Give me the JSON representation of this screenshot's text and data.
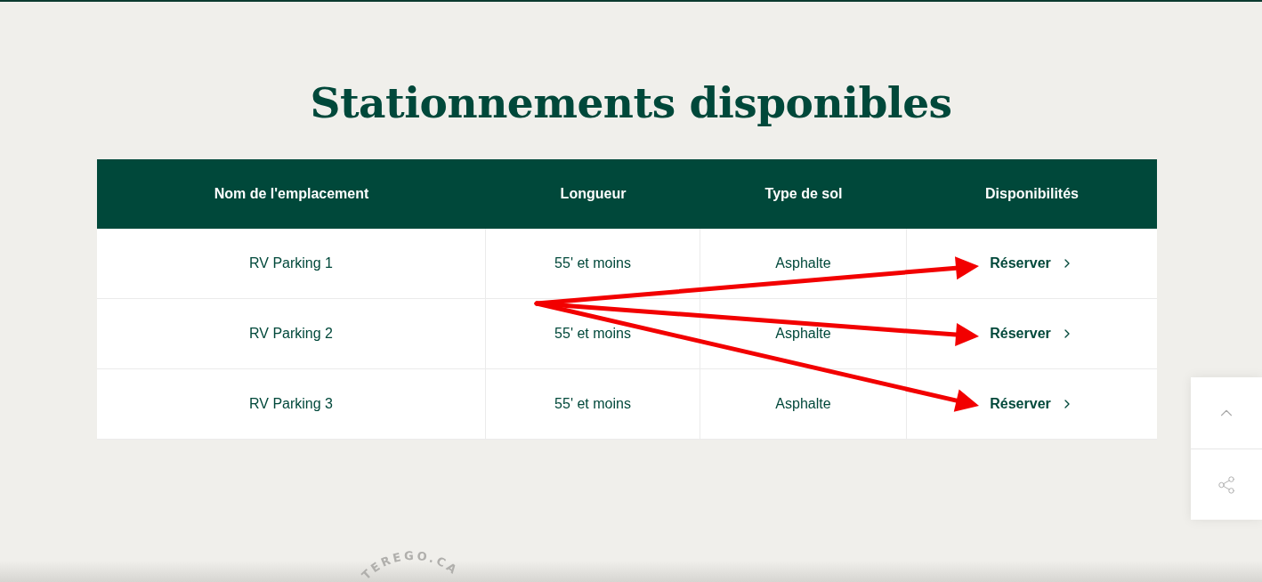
{
  "title": "Stationnements disponibles",
  "table": {
    "columns": [
      "Nom de l'emplacement",
      "Longueur",
      "Type de sol",
      "Disponibilités"
    ],
    "rows": [
      {
        "name": "RV Parking 1",
        "length": "55' et moins",
        "ground": "Asphalte",
        "action": "Réserver",
        "arrowed": true
      },
      {
        "name": "RV Parking 2",
        "length": "55' et moins",
        "ground": "Asphalte",
        "action": "Réserver",
        "arrowed": true
      },
      {
        "name": "RV Parking 3",
        "length": "55' et moins",
        "ground": "Asphalte",
        "action": "Réserver",
        "arrowed": true
      }
    ]
  },
  "badge": "TEREGO.CA"
}
